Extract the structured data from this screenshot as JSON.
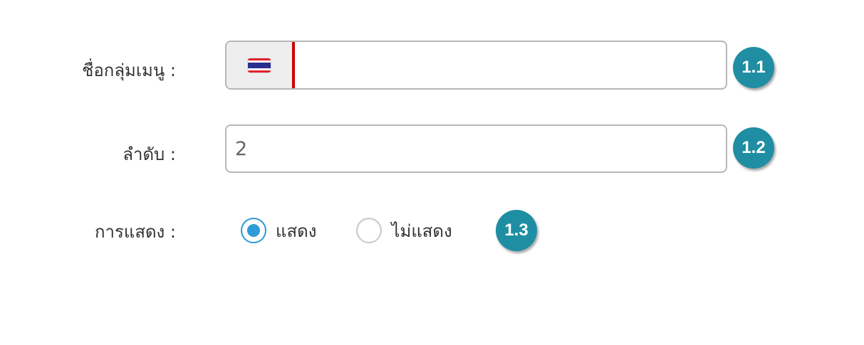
{
  "form": {
    "menu_group_name": {
      "label": "ชื่อกลุ่มเมนู :",
      "value": "",
      "flag_icon": "thailand-flag-icon"
    },
    "order": {
      "label": "ลำดับ :",
      "value": "2"
    },
    "display": {
      "label": "การแสดง :",
      "options": [
        {
          "label": "แสดง",
          "checked": true
        },
        {
          "label": "ไม่แสดง",
          "checked": false
        }
      ]
    }
  },
  "annotations": [
    "1.1",
    "1.2",
    "1.3"
  ],
  "colors": {
    "badge": "#1f8ea3",
    "radio_checked": "#2f9bd6",
    "addon_border": "#cc0000",
    "field_border": "#b7b7b7"
  }
}
